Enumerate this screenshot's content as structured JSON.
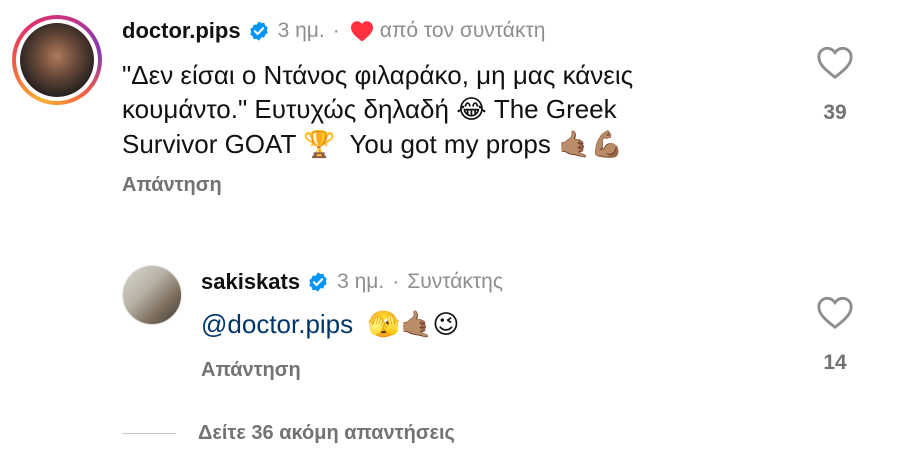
{
  "comments": [
    {
      "username": "doctor.pips",
      "time": "3 ημ.",
      "dot": "·",
      "liked_by_creator": "από τον συντάκτη",
      "text_line1": "\"Δεν είσαι ο Ντάνος φιλαράκο, μη μας κάνεις",
      "text_line2_a": "κουμάντο.\" Ευτυχώς δηλαδή",
      "emoji_laugh": "😂",
      "text_line2_b": " The Greek",
      "text_line3_a": "Survivor GOAT",
      "emoji_trophy": "🏆",
      "text_line3_b": "You got my props",
      "emoji_hand": "🤙🏽",
      "emoji_muscle": "💪🏽",
      "reply_label": "Απάντηση",
      "like_count": "39",
      "icons": {
        "verified": "verified-badge-icon",
        "heart": "heart-outline-icon",
        "liked": "red-heart-icon"
      }
    },
    {
      "username": "sakiskats",
      "time": "3 ημ.",
      "dot": "·",
      "role": "Συντάκτης",
      "mention": "@doctor.pips",
      "emoji_1": "🫣",
      "emoji_2": "🤙🏽",
      "emoji_3": "😉",
      "reply_label": "Απάντηση",
      "like_count": "14",
      "icons": {
        "verified": "verified-badge-icon",
        "heart": "heart-outline-icon"
      }
    }
  ],
  "view_more": "Δείτε 36 ακόμη απαντήσεις",
  "colors": {
    "verified": "#0095f6",
    "heart_red": "#ff3040",
    "meta_gray": "#8e8e8e",
    "mention": "#00376b"
  }
}
